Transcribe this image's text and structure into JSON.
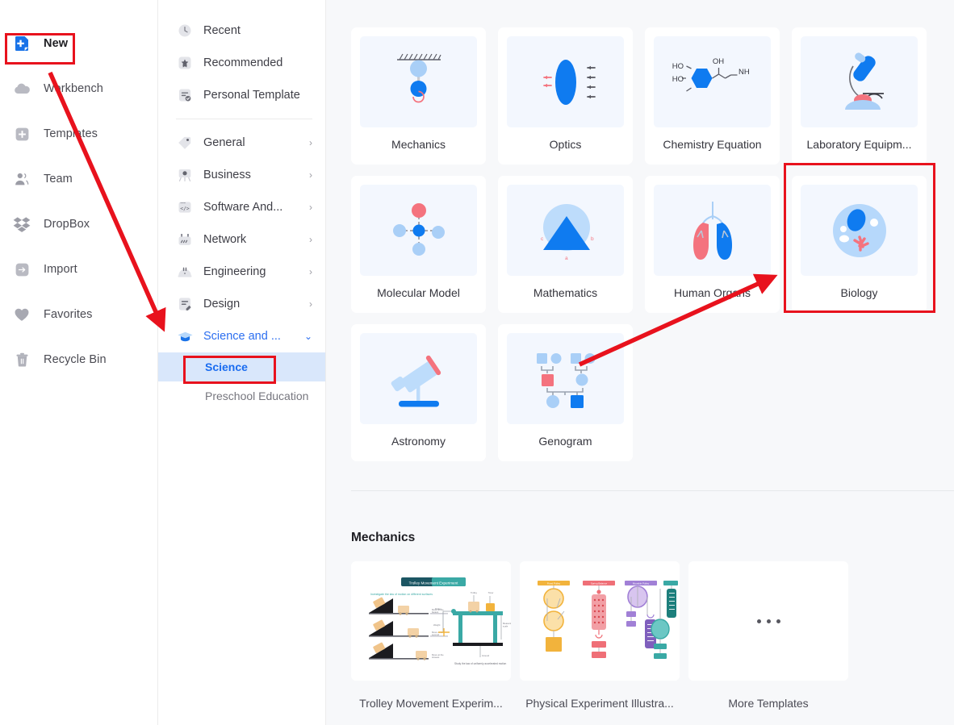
{
  "app": {
    "accent_blue": "#1a73e8",
    "annotation_red": "#e8121d",
    "selected_bg": "#d9e7fb",
    "canvas_bg": "#f7f8fa"
  },
  "sidebar": {
    "items": [
      {
        "label": "New",
        "icon": "new-document-icon",
        "active": true
      },
      {
        "label": "Workbench",
        "icon": "cloud-icon",
        "active": false
      },
      {
        "label": "Templates",
        "icon": "template-grid-icon",
        "active": false
      },
      {
        "label": "Team",
        "icon": "team-people-icon",
        "active": false
      },
      {
        "label": "DropBox",
        "icon": "dropbox-icon",
        "active": false
      },
      {
        "label": "Import",
        "icon": "import-arrow-icon",
        "active": false
      },
      {
        "label": "Favorites",
        "icon": "heart-icon",
        "active": false
      },
      {
        "label": "Recycle Bin",
        "icon": "trash-icon",
        "active": false
      }
    ]
  },
  "categories": {
    "quick": [
      {
        "label": "Recent",
        "icon": "clock-icon"
      },
      {
        "label": "Recommended",
        "icon": "star-bookmark-icon"
      },
      {
        "label": "Personal Template",
        "icon": "personal-template-icon"
      }
    ],
    "groups": [
      {
        "label": "General",
        "icon": "tag-icon",
        "chevron": "›",
        "expanded": false
      },
      {
        "label": "Business",
        "icon": "easel-icon",
        "chevron": "›",
        "expanded": false
      },
      {
        "label": "Software And...",
        "icon": "code-icon",
        "chevron": "›",
        "expanded": false
      },
      {
        "label": "Network",
        "icon": "network-icon",
        "chevron": "›",
        "expanded": false
      },
      {
        "label": "Engineering",
        "icon": "helmet-icon",
        "chevron": "›",
        "expanded": false
      },
      {
        "label": "Design",
        "icon": "design-pen-icon",
        "chevron": "›",
        "expanded": false
      },
      {
        "label": "Science and ...",
        "icon": "graduation-cap-icon",
        "chevron": "⌄",
        "expanded": true
      }
    ],
    "subitems": [
      {
        "label": "Science",
        "selected": true
      },
      {
        "label": "Preschool Education",
        "selected": false
      }
    ]
  },
  "main": {
    "templates": [
      {
        "label": "Mechanics",
        "thumb": "pendulum-icon"
      },
      {
        "label": "Optics",
        "thumb": "lens-rays-icon"
      },
      {
        "label": "Chemistry Equation",
        "thumb": "molecule-formula-icon"
      },
      {
        "label": "Laboratory Equipm...",
        "thumb": "microscope-icon"
      },
      {
        "label": "Molecular Model",
        "thumb": "molecular-model-icon"
      },
      {
        "label": "Mathematics",
        "thumb": "triangle-circle-icon"
      },
      {
        "label": "Human Organs",
        "thumb": "lungs-icon"
      },
      {
        "label": "Biology",
        "thumb": "cell-icon"
      },
      {
        "label": "Astronomy",
        "thumb": "telescope-icon"
      },
      {
        "label": "Genogram",
        "thumb": "genogram-icon"
      }
    ],
    "section": {
      "title": "Mechanics",
      "items": [
        {
          "label": "Trolley Movement Experim...",
          "thumb": "trolley-experiment-preview"
        },
        {
          "label": "Physical Experiment Illustra...",
          "thumb": "pulley-experiment-preview"
        },
        {
          "label": "More Templates",
          "thumb": "more-dots-icon"
        }
      ]
    },
    "math_thumb_labels": {
      "a": "a",
      "b": "b",
      "c": "c"
    },
    "chem_thumb_labels": {
      "ho1": "HO",
      "ho2": "HO",
      "oh": "OH",
      "nh": "NH"
    },
    "trolley_preview": {
      "title": "Trolley Movement Experiment",
      "subtitle": "Investigate the law of motion on different surfaces",
      "caption": "Study the law of uniformly accelerated motion"
    }
  }
}
